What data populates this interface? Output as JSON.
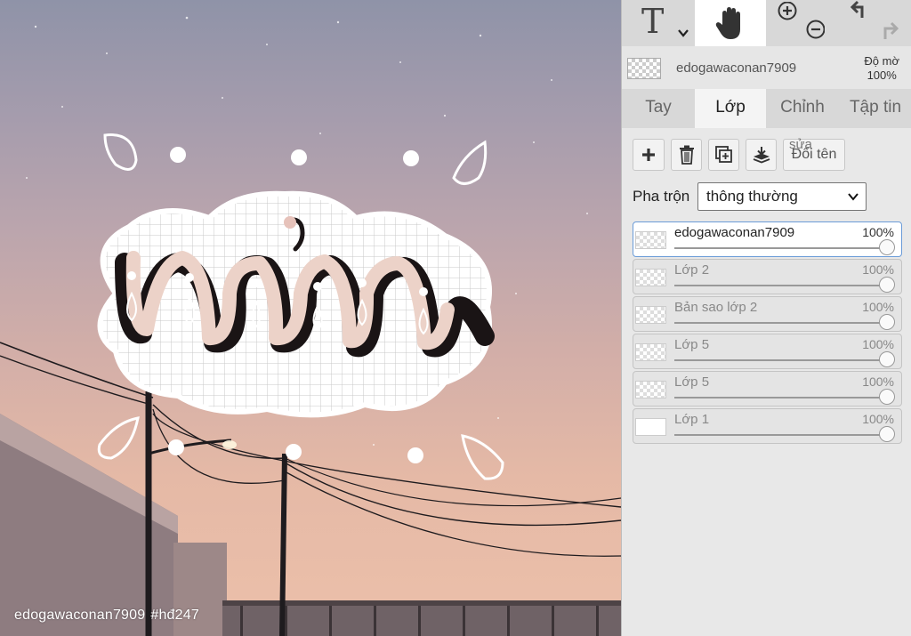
{
  "canvas": {
    "watermark_user": "edogawaconan7909",
    "watermark_tag": "#hđ247"
  },
  "toolbar": {
    "text_tool": "T",
    "text_tool_icon": "text-tool-icon",
    "hand_tool_icon": "hand-icon",
    "zoom_in_icon": "zoom-in-icon",
    "zoom_out_icon": "zoom-out-icon",
    "undo_icon": "undo-icon",
    "redo_icon": "redo-icon"
  },
  "current_layer": {
    "name": "edogawaconan7909",
    "opacity_label": "Độ mờ",
    "opacity_value": "100%"
  },
  "tabs": [
    {
      "label": "Tay"
    },
    {
      "label": "Lớp"
    },
    {
      "label": "Chỉnh"
    },
    {
      "label": "Tập tin"
    }
  ],
  "layer_actions": {
    "add_icon": "plus-icon",
    "delete_icon": "trash-icon",
    "duplicate_icon": "duplicate-icon",
    "merge_icon": "merge-down-icon",
    "rename_label": "Đổi tên",
    "rename_small": "sửa"
  },
  "blend": {
    "label": "Pha trộn",
    "value": "thông thường"
  },
  "layers": [
    {
      "name": "edogawaconan7909",
      "opacity": "100%",
      "selected": true
    },
    {
      "name": "Lớp 2",
      "opacity": "100%",
      "selected": false
    },
    {
      "name": "Bản sao lớp 2",
      "opacity": "100%",
      "selected": false
    },
    {
      "name": "Lớp 5",
      "opacity": "100%",
      "selected": false
    },
    {
      "name": "Lớp 5",
      "opacity": "100%",
      "selected": false
    },
    {
      "name": "Lớp 1",
      "opacity": "100%",
      "selected": false
    }
  ],
  "colors": {
    "panel_bg": "#d8d8d8",
    "selected_layer_border": "#6b9cd8",
    "sky_top": "#8f93a8",
    "sky_bottom": "#ecc0aa"
  }
}
